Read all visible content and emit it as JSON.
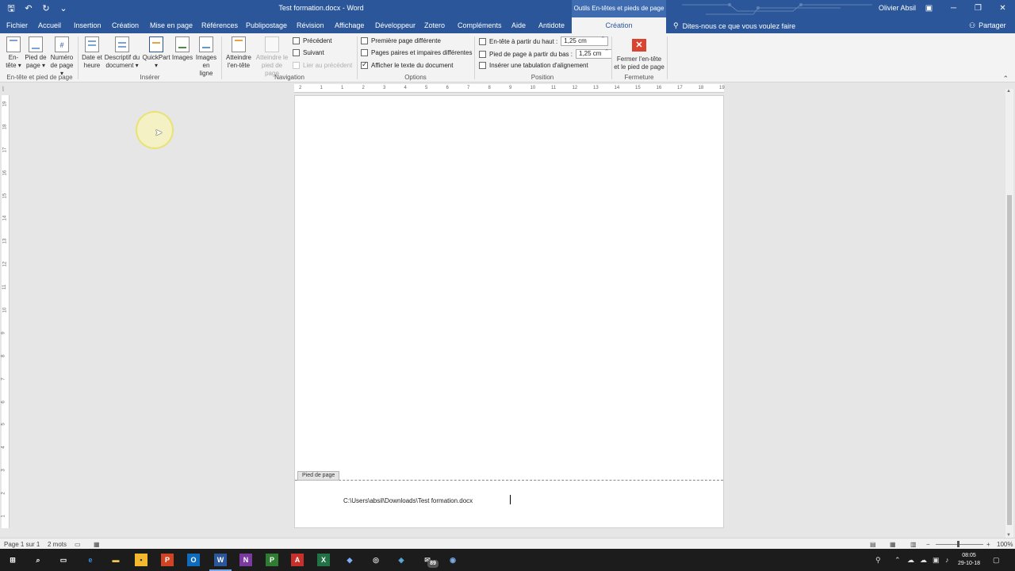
{
  "titlebar": {
    "doc_title": "Test formation.docx - Word",
    "context_title": "Outils En-têtes et pieds de page",
    "user": "Olivier Absil",
    "qat": [
      "save-icon",
      "undo-icon",
      "redo-icon",
      "customize-icon"
    ]
  },
  "tabs": {
    "items": [
      "Fichier",
      "Accueil",
      "Insertion",
      "Création",
      "Mise en page",
      "Références",
      "Publipostage",
      "Révision",
      "Affichage",
      "Développeur",
      "Zotero",
      "Compléments",
      "Aide",
      "Antidote"
    ],
    "active": "Création",
    "tellme": "Dites-nous ce que vous voulez faire",
    "share": "Partager"
  },
  "ribbon": {
    "header_footer": {
      "entete": [
        "En-",
        "tête ▾"
      ],
      "pied": [
        "Pied de",
        "page ▾"
      ],
      "numero": [
        "Numéro",
        "de page ▾"
      ],
      "group": "En-tête et pied de page"
    },
    "insert": {
      "date": [
        "Date et",
        "heure"
      ],
      "descriptif": [
        "Descriptif du",
        "document ▾"
      ],
      "quickpart": [
        "QuickPart",
        "▾"
      ],
      "images": [
        "Images",
        ""
      ],
      "images_online": [
        "Images",
        "en ligne"
      ],
      "group": "Insérer"
    },
    "navigation": {
      "goto_header": [
        "Atteindre",
        "l'en-tête"
      ],
      "goto_footer": [
        "Atteindre le",
        "pied de page"
      ],
      "previous": "Précédent",
      "next": "Suivant",
      "link_previous": "Lier au précédent",
      "group": "Navigation"
    },
    "options": {
      "first_page": "Première page différente",
      "odd_even": "Pages paires et impaires différentes",
      "show_text": "Afficher le texte du document",
      "group": "Options"
    },
    "position": {
      "header_label": "En-tête à partir du haut :",
      "header_value": "1,25 cm",
      "footer_label": "Pied de page à partir du bas :",
      "footer_value": "1,25 cm",
      "tab_align": "Insérer une tabulation d'alignement",
      "group": "Position"
    },
    "close": {
      "label": [
        "Fermer l'en-tête",
        "et le pied de page"
      ],
      "group": "Fermeture"
    }
  },
  "ruler": {
    "h_ticks": [
      "2",
      "1",
      "1",
      "2",
      "3",
      "4",
      "5",
      "6",
      "7",
      "8",
      "9",
      "10",
      "11",
      "12",
      "13",
      "14",
      "15",
      "16",
      "17",
      "18",
      "19"
    ],
    "v_ticks": [
      "19",
      "18",
      "17",
      "16",
      "15",
      "14",
      "13",
      "12",
      "11",
      "10",
      "9",
      "8",
      "7",
      "6",
      "5",
      "4",
      "3",
      "2",
      "1"
    ]
  },
  "document": {
    "footer_tag": "Pied de page",
    "footer_text": "C:\\Users\\absil\\Downloads\\Test formation.docx"
  },
  "statusbar": {
    "page": "Page 1 sur 1",
    "words": "2 mots",
    "zoom": "100%",
    "zoom_level_percent": 100
  },
  "taskbar": {
    "apps": [
      "start-icon",
      "search-icon",
      "task-view-icon",
      "edge-icon",
      "file-explorer-icon",
      "store-icon",
      "powerpoint-icon",
      "outlook-icon",
      "word-icon",
      "onenote-icon",
      "project-icon",
      "acrobat-icon",
      "excel-icon",
      "app-icon",
      "vscode-icon",
      "mail-icon",
      "cortana-icon"
    ],
    "mail_badge": "89",
    "time": "08:05",
    "date": "29-10-18"
  }
}
